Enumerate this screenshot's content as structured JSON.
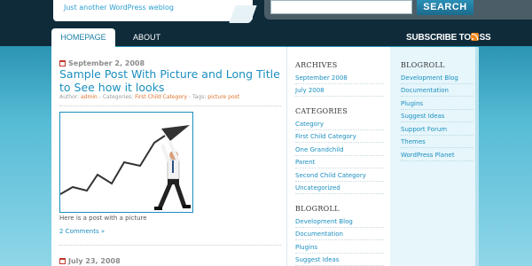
{
  "header": {
    "tagline": "Just another WordPress weblog",
    "search_button": "SEARCH",
    "search_value": ""
  },
  "nav": {
    "tabs": [
      {
        "label": "HOMEPAGE",
        "active": true
      },
      {
        "label": "ABOUT",
        "active": false
      }
    ],
    "rss_label": "SUBSCRIBE TO RSS"
  },
  "posts": [
    {
      "date": "September 2, 2008",
      "title": "Sample Post With Picture and Long Title to See how it looks",
      "meta_prefix": "Author: ",
      "author": "admin",
      "meta_categories_label": " - Categories: ",
      "category": "First Child Category",
      "meta_tags_label": " - Tags: ",
      "tag": "picture post",
      "caption": "Here is a post with a picture",
      "comments": "2 Comments »"
    },
    {
      "date": "July 23, 2008"
    }
  ],
  "sidebar1": {
    "archives_title": "ARCHIVES",
    "archives": [
      "September 2008",
      "July 2008"
    ],
    "categories_title": "CATEGORIES",
    "categories": [
      "Category",
      "First Child Category",
      "One Grandchild",
      "Parent",
      "Second Child Category",
      "Uncategorized"
    ],
    "blogroll_title": "BLOGROLL",
    "blogroll": [
      "Development Blog",
      "Documentation",
      "Plugins",
      "Suggest Ideas"
    ]
  },
  "sidebar2": {
    "blogroll_title": "BLOGROLL",
    "blogroll": [
      "Development Blog",
      "Documentation",
      "Plugins",
      "Suggest Ideas",
      "Support Forum",
      "Themes",
      "WordPress Planet"
    ]
  },
  "colors": {
    "accent": "#1b8fc0",
    "header": "#0f2b3a",
    "meta_link": "#e0742d",
    "rss": "#f28a1e"
  }
}
